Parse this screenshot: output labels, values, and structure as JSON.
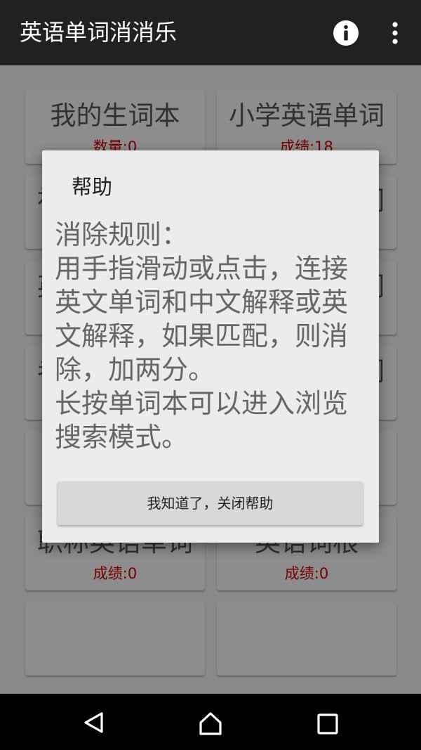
{
  "appbar": {
    "title": "英语单词消消乐",
    "info_icon": "info-icon",
    "overflow_icon": "more-vert-icon"
  },
  "cards": [
    {
      "name": "我的生词本",
      "score": "数量:0"
    },
    {
      "name": "小学英语单词",
      "score": "成绩:18"
    },
    {
      "name": "初中英语单词",
      "score": ""
    },
    {
      "name": "高中英语单词",
      "score": ""
    },
    {
      "name": "英语四级单词",
      "score": ""
    },
    {
      "name": "英语六级单词",
      "score": ""
    },
    {
      "name": "考研英语单词",
      "score": ""
    },
    {
      "name": "托福英语单词",
      "score": ""
    },
    {
      "name": "",
      "score": ""
    },
    {
      "name": "",
      "score": ""
    },
    {
      "name": "职称英语单词",
      "score": "成绩:0"
    },
    {
      "name": "英语词根",
      "score": "成绩:0"
    },
    {
      "name": "",
      "score": ""
    },
    {
      "name": "",
      "score": ""
    }
  ],
  "dialog": {
    "title": "帮助",
    "message": "消除规则：\n用手指滑动或点击，连接英文单词和中文解释或英文解释，如果匹配，则消除，加两分。\n长按单词本可以进入浏览搜索模式。",
    "button_label": "我知道了，关闭帮助"
  },
  "navbar": {
    "back_icon": "back-icon",
    "home_icon": "home-icon",
    "recents_icon": "recents-icon"
  },
  "colors": {
    "appbar": "#212121",
    "score_red": "#cc0000",
    "dialog_bg": "#ececec"
  }
}
